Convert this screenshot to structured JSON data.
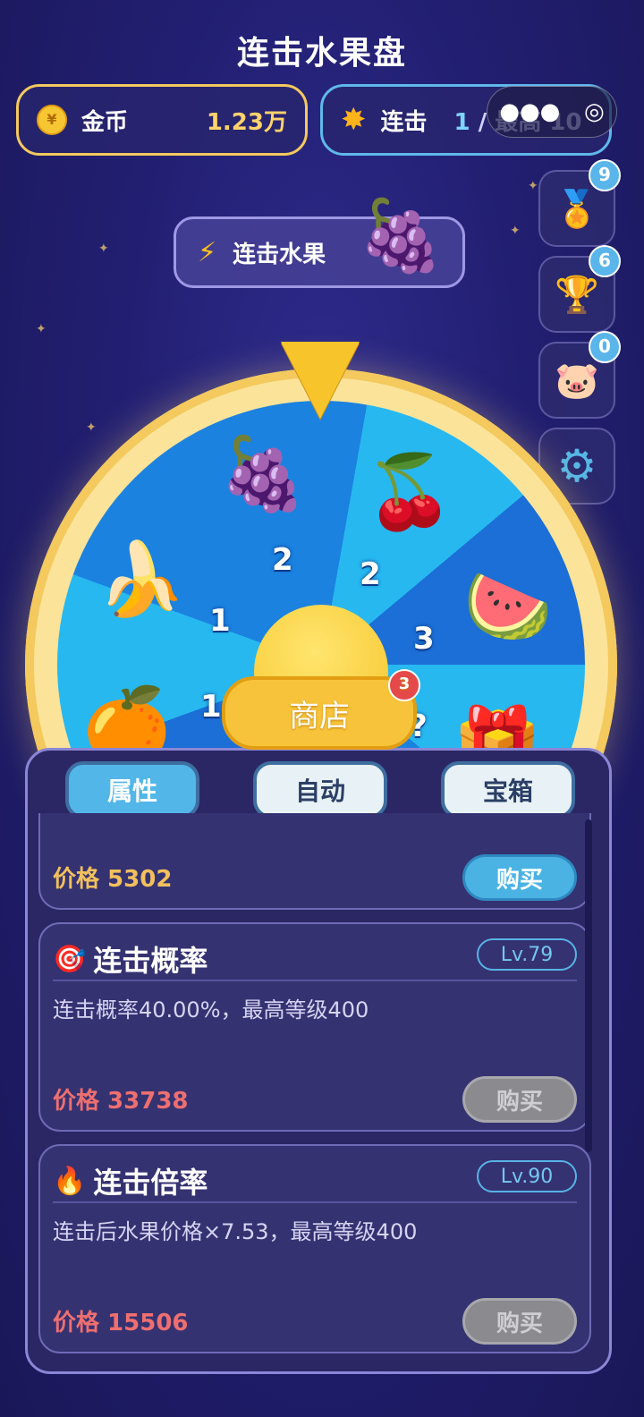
{
  "header": {
    "title": "连击水果盘"
  },
  "stats": {
    "coins": {
      "icon": "yen-coin-icon",
      "label": "金币",
      "value": "1.23万"
    },
    "combo": {
      "icon": "burst-icon",
      "label": "连击",
      "current": "1",
      "best_label": "/ 最高",
      "best_value": "10"
    }
  },
  "capsule": {
    "more_icon": "●●●",
    "close_icon": "◎"
  },
  "combo_fruit": {
    "icon": "lightning-icon",
    "label": "连击水果",
    "fruit": "🍇"
  },
  "side_buttons": [
    {
      "name": "medal",
      "icon": "🏅",
      "badge": "9"
    },
    {
      "name": "trophy",
      "icon": "🏆",
      "badge": "6"
    },
    {
      "name": "piggy-bank",
      "icon": "🐷",
      "badge": "0"
    },
    {
      "name": "settings",
      "icon": "⚙"
    }
  ],
  "wheel": {
    "slots": [
      {
        "fruit": "🍇",
        "value": "2"
      },
      {
        "fruit": "🍒",
        "value": "2"
      },
      {
        "fruit": "🍉",
        "value": "3"
      },
      {
        "fruit": "🎁",
        "value": "?"
      },
      {
        "fruit": "🍊",
        "value": "1"
      },
      {
        "fruit": "🍌",
        "value": "1"
      }
    ]
  },
  "shop": {
    "label": "商店",
    "badge": "3"
  },
  "tabs": [
    {
      "label": "属性",
      "active": true
    },
    {
      "label": "自动",
      "active": false
    },
    {
      "label": "宝箱",
      "active": false
    }
  ],
  "upgrades": [
    {
      "title": "",
      "price_label": "价格 5302",
      "buy_label": "购买",
      "affordable": true
    },
    {
      "icon": "🎯",
      "title": "连击概率",
      "level": "Lv.79",
      "desc": "连击概率40.00%，最高等级400",
      "price_label": "价格 33738",
      "buy_label": "购买",
      "affordable": false
    },
    {
      "icon": "🔥",
      "title": "连击倍率",
      "level": "Lv.90",
      "desc": "连击后水果价格×7.53，最高等级400",
      "price_label": "价格 15506",
      "buy_label": "购买",
      "affordable": false
    }
  ],
  "colors": {
    "gold": "#f4c95d",
    "blue": "#5fb8ea",
    "bg": "#221f72",
    "price_ok": "#f2c05c",
    "price_bad": "#ee6f6f"
  }
}
